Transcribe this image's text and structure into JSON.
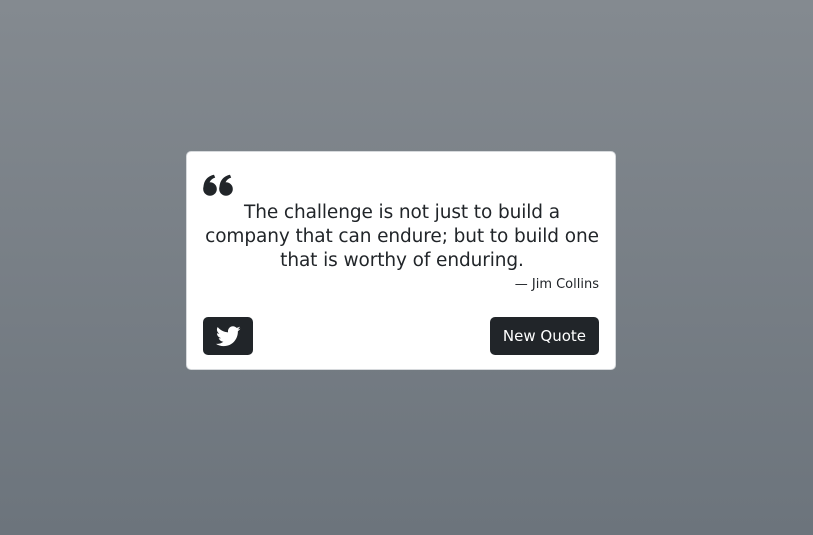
{
  "card": {
    "quote_icon": "quote-left-icon",
    "quote": "The challenge is not just to build a company that can endure; but to build one that is worthy of enduring.",
    "author": "— Jim Collins",
    "tweet_icon": "twitter-icon",
    "new_quote_label": "New Quote"
  },
  "colors": {
    "background_top": "#848a90",
    "background_bottom": "#6c747c",
    "card": "#ffffff",
    "text": "#212529",
    "button": "#212529",
    "button_text": "#ffffff"
  }
}
